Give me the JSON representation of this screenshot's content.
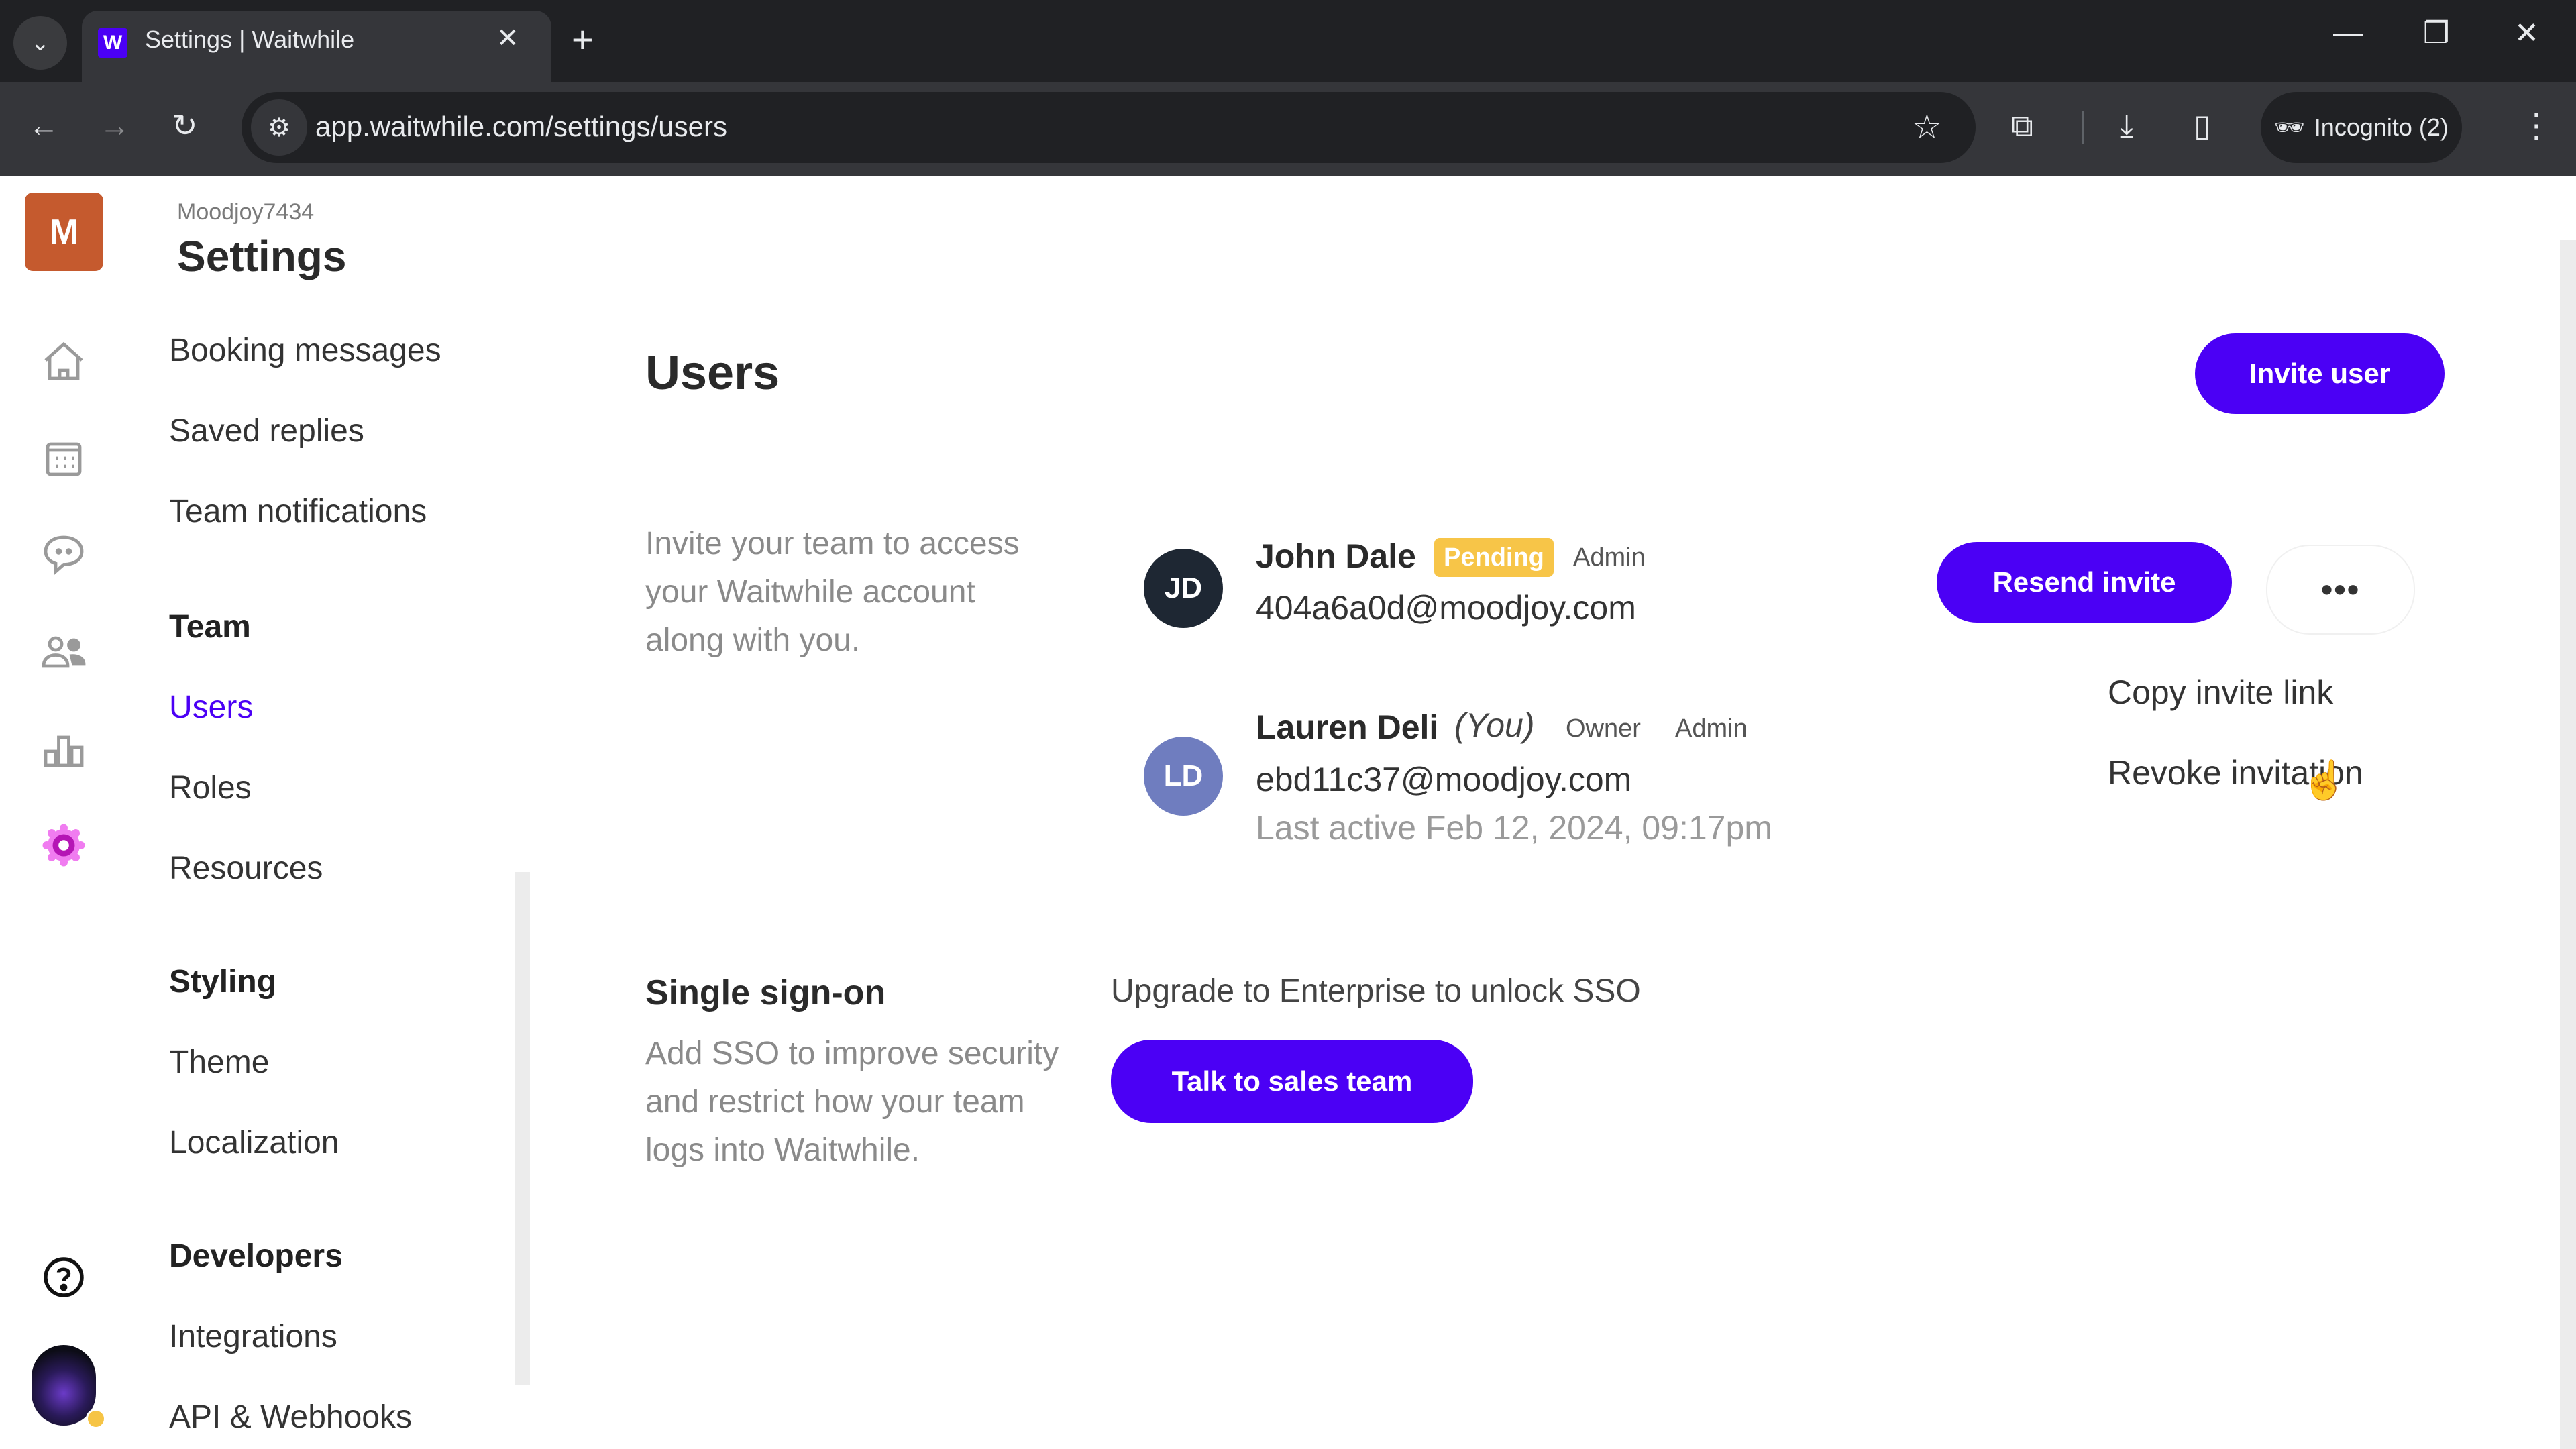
{
  "browser": {
    "tab_title": "Settings | Waitwhile",
    "favicon_letter": "W",
    "url": "app.waitwhile.com/settings/users",
    "incognito_label": "Incognito (2)",
    "icons": {
      "tab_list": "chevron-down-icon",
      "close_tab": "close-icon",
      "new_tab": "plus-icon",
      "back": "arrow-left-icon",
      "forward": "arrow-right-icon",
      "reload": "reload-icon",
      "site_info": "tune-icon",
      "bookmark": "star-icon",
      "extensions": "puzzle-icon",
      "downloads": "download-icon",
      "side_panel": "side-panel-icon",
      "incognito": "incognito-icon",
      "menu": "more-vertical-icon",
      "minimize": "minimize-icon",
      "restore": "restore-icon",
      "close_window": "close-icon"
    }
  },
  "rail": {
    "logo_letter": "M",
    "logo_color": "#c55a2e",
    "items": [
      {
        "name": "home",
        "icon": "home-icon"
      },
      {
        "name": "calendar",
        "icon": "calendar-icon"
      },
      {
        "name": "messages",
        "icon": "chat-bubble-icon"
      },
      {
        "name": "customers",
        "icon": "users-icon"
      },
      {
        "name": "analytics",
        "icon": "bar-chart-icon"
      },
      {
        "name": "settings",
        "icon": "gear-icon",
        "active": true
      }
    ],
    "help_icon": "help-circle-icon",
    "status_color": "#f6c445"
  },
  "settings_nav": {
    "org_name": "Moodjoy7434",
    "title": "Settings",
    "top_items": [
      "Booking messages",
      "Saved replies",
      "Team notifications"
    ],
    "sections": [
      {
        "heading": "Team",
        "items": [
          "Users",
          "Roles",
          "Resources"
        ]
      },
      {
        "heading": "Styling",
        "items": [
          "Theme",
          "Localization"
        ]
      },
      {
        "heading": "Developers",
        "items": [
          "Integrations",
          "API & Webhooks"
        ]
      }
    ],
    "active_item": "Users"
  },
  "main": {
    "title": "Users",
    "invite_button": "Invite user",
    "description": "Invite your team to access your Waitwhile account along with you.",
    "users": [
      {
        "initials": "JD",
        "name": "John Dale",
        "badge": "Pending",
        "roles": [
          "Admin"
        ],
        "email": "404a6a0d@moodjoy.com",
        "avatar_color": "#1e2733"
      },
      {
        "initials": "LD",
        "name": "Lauren Deli",
        "you_label": "(You)",
        "roles": [
          "Owner",
          "Admin"
        ],
        "email": "ebd11c37@moodjoy.com",
        "last_active": "Last active Feb 12, 2024, 09:17pm",
        "avatar_color": "#6f7dbf"
      }
    ],
    "resend_button": "Resend invite",
    "more_button": "•••",
    "menu": [
      "Copy invite link",
      "Revoke invitation"
    ],
    "sso": {
      "title": "Single sign-on",
      "description": "Add SSO to improve security and restrict how your team logs into Waitwhile.",
      "upgrade_text": "Upgrade to Enterprise to unlock SSO",
      "button": "Talk to sales team"
    }
  },
  "colors": {
    "accent": "#4b00f5",
    "pending": "#f7c548"
  }
}
